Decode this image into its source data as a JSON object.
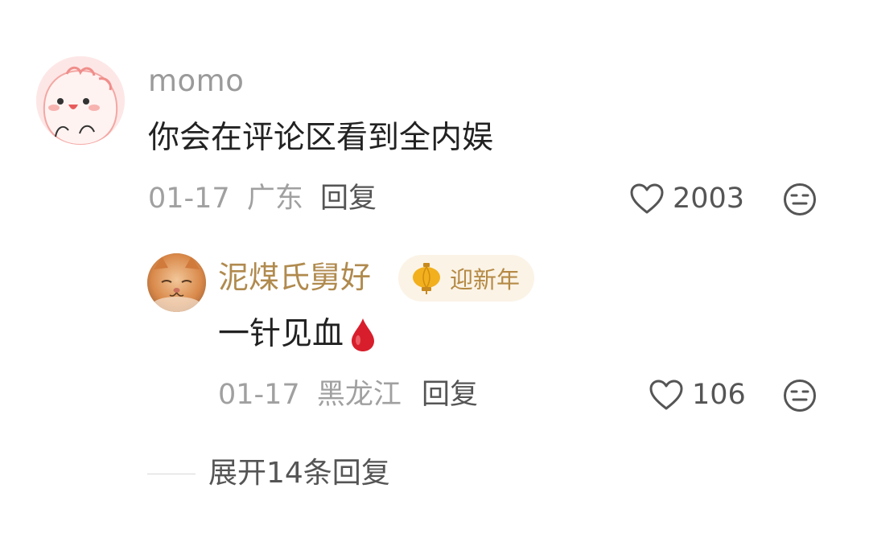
{
  "comment": {
    "username": "momo",
    "text": "你会在评论区看到全内娱",
    "date": "01-17",
    "location": "广东",
    "reply_label": "回复",
    "likes": "2003",
    "icons": {
      "avatar": "cartoon-pink-blob-avatar",
      "like": "heart-outline-icon",
      "dislike": "neutral-face-icon"
    }
  },
  "reply": {
    "username": "泥煤氏舅好",
    "badge_label": "迎新年",
    "text": "一针见血",
    "emoji": "blood-drop-emoji",
    "date": "01-17",
    "location": "黑龙江",
    "reply_label": "回复",
    "likes": "106",
    "icons": {
      "avatar": "orange-cat-photo-avatar",
      "badge": "golden-lantern-icon",
      "like": "heart-outline-icon",
      "dislike": "neutral-face-icon"
    }
  },
  "expand": {
    "label": "展开14条回复"
  },
  "colors": {
    "username_gray": "#9a9a9a",
    "reply_username_gold": "#b08a4e",
    "badge_bg": "#fbf3e6",
    "badge_text": "#b58a45",
    "blood_red": "#d81e2c",
    "meta_gray": "#a0a0a0",
    "action_gray": "#555555"
  }
}
